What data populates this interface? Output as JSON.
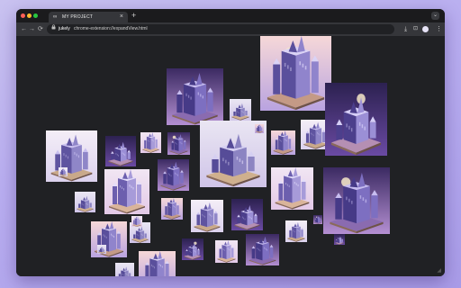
{
  "window": {
    "controls": [
      {
        "name": "close",
        "color": "#ff5f57"
      },
      {
        "name": "minimize",
        "color": "#febc2e"
      },
      {
        "name": "maximize",
        "color": "#28c840"
      }
    ]
  },
  "tab": {
    "title": "MY PROJECT",
    "favicon": "∞",
    "close_glyph": "×",
    "new_tab_glyph": "+",
    "menu_glyph": "⌄"
  },
  "toolbar": {
    "back_glyph": "←",
    "forward_glyph": "→",
    "reload_glyph": "⟳",
    "lock_glyph": "🔒",
    "host": "jukely",
    "url_path": "chrome-extension://expandView.html",
    "download_glyph": "⤓",
    "extensions_glyph": "⊡",
    "more_glyph": "⋮"
  },
  "gallery": {
    "tile_count": 33,
    "tiles": [
      {
        "bg": "#efe4f4",
        "kind": "castle"
      },
      {
        "bg": "#f3eefa",
        "kind": "tower"
      },
      {
        "bg": "#e9e1f2",
        "kind": "castle"
      },
      {
        "bg": "#2a2046",
        "kind": "tower"
      },
      {
        "bg": "#ece6f6",
        "kind": "castle"
      }
    ]
  }
}
